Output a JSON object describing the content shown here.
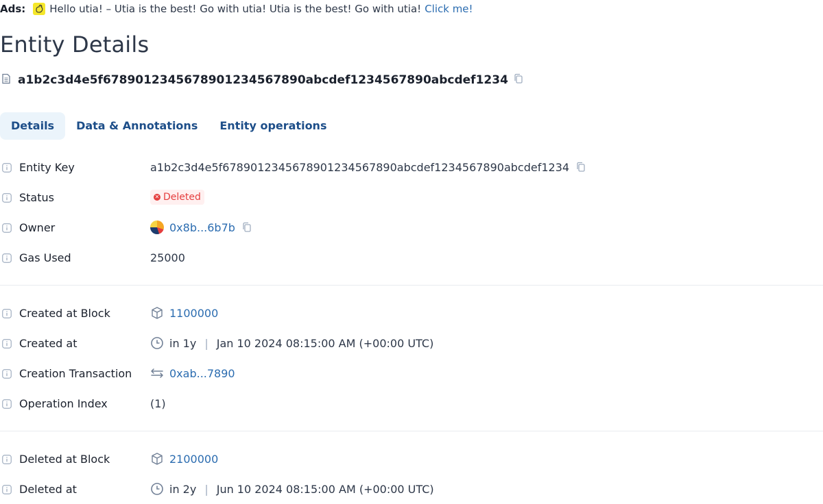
{
  "ads": {
    "label": "Ads:",
    "text": "Hello utia! – Utia is the best! Go with utia! Utia is the best! Go with utia!",
    "link": "Click me!"
  },
  "page": {
    "title": "Entity Details",
    "entity_hash": "a1b2c3d4e5f6789012345678901234567890abcdef1234567890abcdef1234"
  },
  "tabs": [
    {
      "label": "Details",
      "active": true
    },
    {
      "label": "Data & Annotations",
      "active": false
    },
    {
      "label": "Entity operations",
      "active": false
    }
  ],
  "details": {
    "entity_key": {
      "label": "Entity Key",
      "value": "a1b2c3d4e5f6789012345678901234567890abcdef1234567890abcdef1234"
    },
    "status": {
      "label": "Status",
      "value": "Deleted"
    },
    "owner": {
      "label": "Owner",
      "value": "0x8b...6b7b"
    },
    "gas_used": {
      "label": "Gas Used",
      "value": "25000"
    },
    "created_block": {
      "label": "Created at Block",
      "value": "1100000"
    },
    "created_at": {
      "label": "Created at",
      "relative": "in 1y",
      "absolute": "Jan 10 2024 08:15:00 AM (+00:00 UTC)"
    },
    "creation_tx": {
      "label": "Creation Transaction",
      "value": "0xab...7890"
    },
    "operation_index": {
      "label": "Operation Index",
      "value": "(1)"
    },
    "deleted_block": {
      "label": "Deleted at Block",
      "value": "2100000"
    },
    "deleted_at": {
      "label": "Deleted at",
      "relative": "in 2y",
      "absolute": "Jun 10 2024 08:15:00 AM (+00:00 UTC)"
    }
  },
  "colors": {
    "link": "#2b6cb0",
    "tab_text": "#1d4e89",
    "status_deleted": "#e53e3e"
  }
}
